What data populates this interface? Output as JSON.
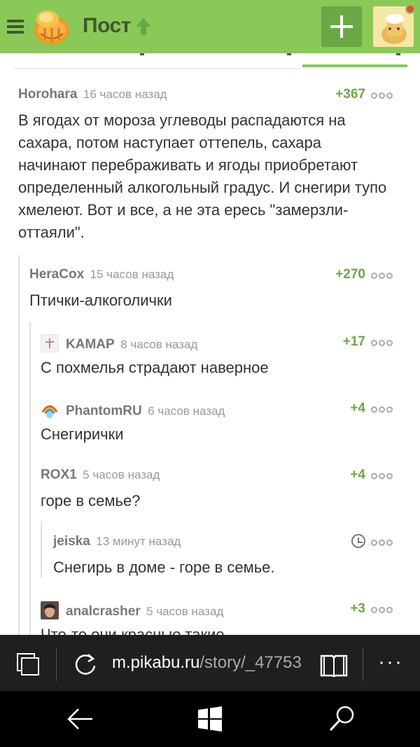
{
  "header": {
    "title": "Пост",
    "brand_color": "#8ac858",
    "icons": [
      "menu-icon",
      "pikabu-logo",
      "arrow-up-icon",
      "plus-icon",
      "user-avatar",
      "notification-dot"
    ]
  },
  "comments": [
    {
      "user": "Horohara",
      "time": "16 часов назад",
      "score": "+367",
      "text": "В ягодах от мороза углеводы распадаются на сахара, потом наступает оттепель, сахара начинают перебраживать и ягоды приобретают определенный алкогольный градус. И снегири тупо хмелеют. Вот и все, а не эта ересь \"замерзли-оттаяли\"."
    },
    {
      "user": "HeraCox",
      "time": "15 часов назад",
      "score": "+270",
      "text": "Птички-алкоголички"
    },
    {
      "user": "KAMAP",
      "time": "8 часов назад",
      "score": "+17",
      "text": "С похмелья страдают наверное"
    },
    {
      "user": "PhantomRU",
      "time": "6 часов назад",
      "score": "+4",
      "text": "Снегирички"
    },
    {
      "user": "ROX1",
      "time": "5 часов назад",
      "score": "+4",
      "text": "горе в семье?"
    },
    {
      "user": "jeiska",
      "time": "13 минут назад",
      "score": "",
      "text": "Снегирь в доме - горе в семье."
    },
    {
      "user": "analcrasher",
      "time": "5 часов назад",
      "score": "+3",
      "text": "Что-то они красные такие"
    }
  ],
  "browser": {
    "url_host": "m.pikabu.ru",
    "url_path": "/story/_47753",
    "more_label": "···"
  }
}
